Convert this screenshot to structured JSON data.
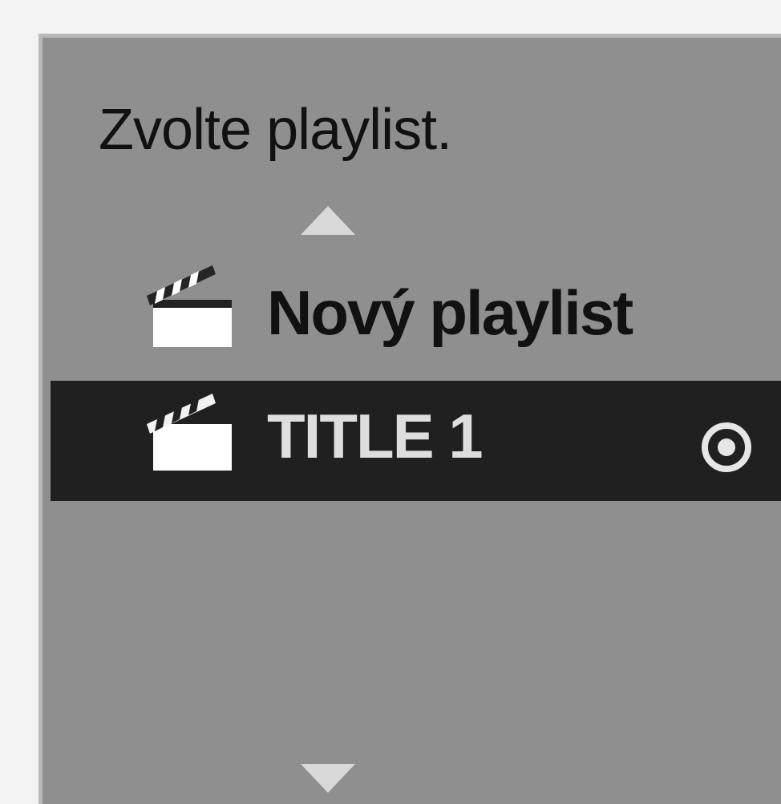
{
  "dialog": {
    "prompt": "Zvolte playlist.",
    "scroll_up_icon": "triangle-up-icon",
    "scroll_down_icon": "triangle-down-icon",
    "items": [
      {
        "label": "Nový playlist",
        "icon": "clapperboard-icon",
        "selected": false
      },
      {
        "label": "TITLE 1",
        "icon": "clapperboard-icon",
        "selected": true,
        "marker_icon": "selected-target-icon"
      }
    ]
  },
  "colors": {
    "panel": "#8f8f8f",
    "selected_row": "#202020",
    "text": "#111111",
    "selected_text": "#dedede",
    "arrow": "#d9d9d9"
  }
}
